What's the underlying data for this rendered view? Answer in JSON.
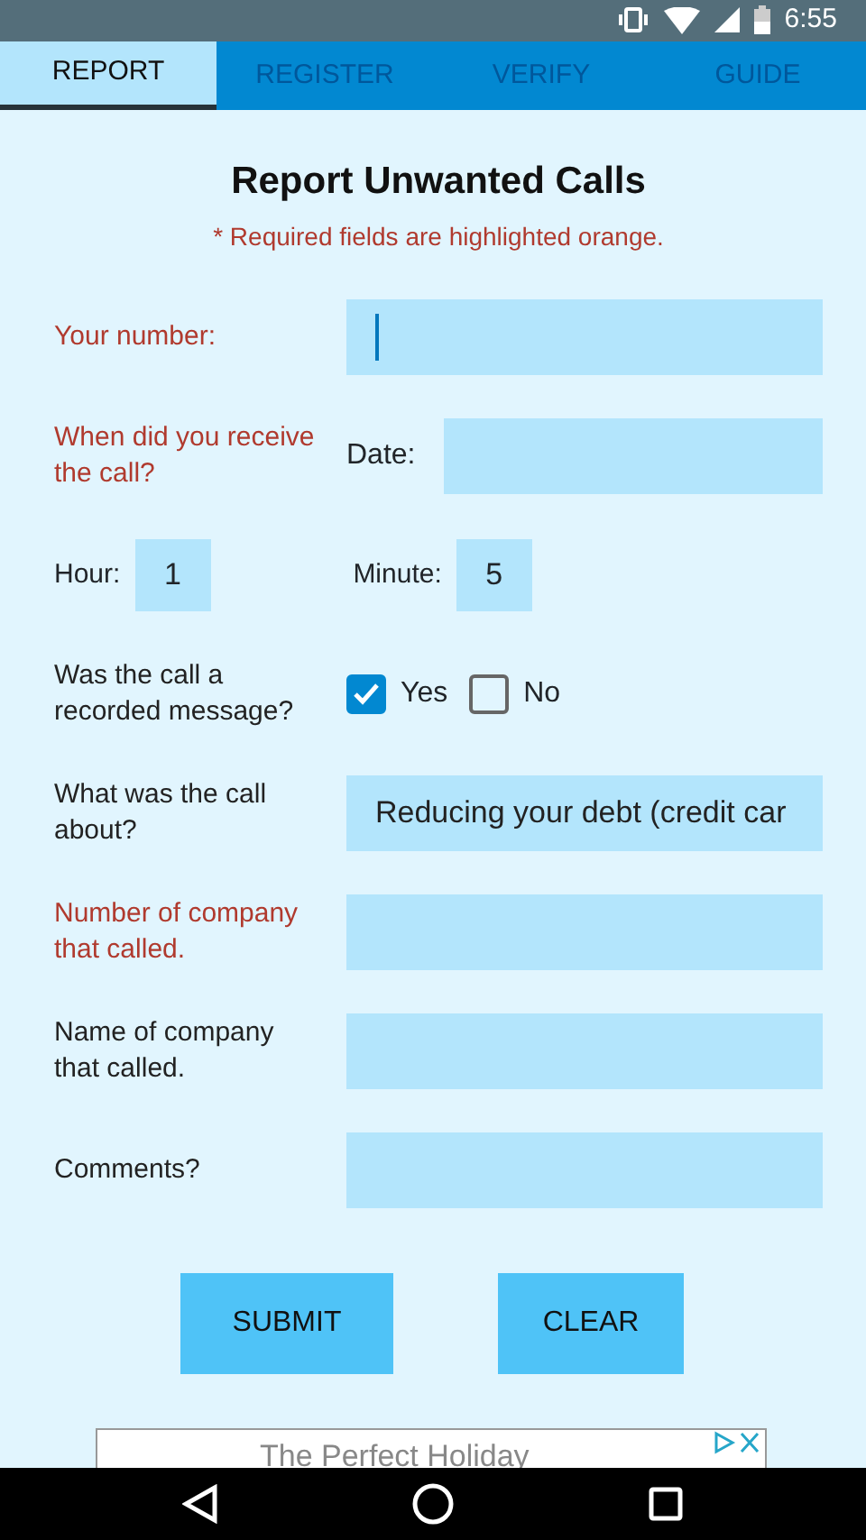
{
  "status_bar": {
    "time": "6:55"
  },
  "tabs": [
    {
      "label": "REPORT",
      "selected": true
    },
    {
      "label": "REGISTER",
      "selected": false
    },
    {
      "label": "VERIFY",
      "selected": false
    },
    {
      "label": "GUIDE",
      "selected": false
    }
  ],
  "form": {
    "title": "Report Unwanted Calls",
    "note": "* Required fields are highlighted orange.",
    "rows": [
      {
        "kind": "text",
        "label": "Your number:",
        "required": true,
        "focused": true
      },
      {
        "kind": "date",
        "label": "When did you receive the call?",
        "required": true,
        "sublabel": "Date:"
      },
      {
        "kind": "time",
        "hour_label": "Hour:",
        "hour": "1",
        "minute_label": "Minute:",
        "minute": "5"
      },
      {
        "kind": "choice",
        "label": "Was the call a recorded message?",
        "required": false,
        "options": [
          {
            "label": "Yes",
            "checked": true
          },
          {
            "label": "No",
            "checked": false
          }
        ]
      },
      {
        "kind": "select",
        "label": "What was the call about?",
        "required": false,
        "value": "Reducing your debt (credit car"
      },
      {
        "kind": "text",
        "label": "Number of company that called.",
        "required": true,
        "focused": false
      },
      {
        "kind": "text",
        "label": "Name of company that called.",
        "required": false,
        "focused": false
      },
      {
        "kind": "text",
        "label": "Comments?",
        "required": false,
        "focused": false
      }
    ]
  },
  "buttons": [
    "SUBMIT",
    "CLEAR"
  ],
  "ad": {
    "text": "The Perfect Holiday"
  }
}
